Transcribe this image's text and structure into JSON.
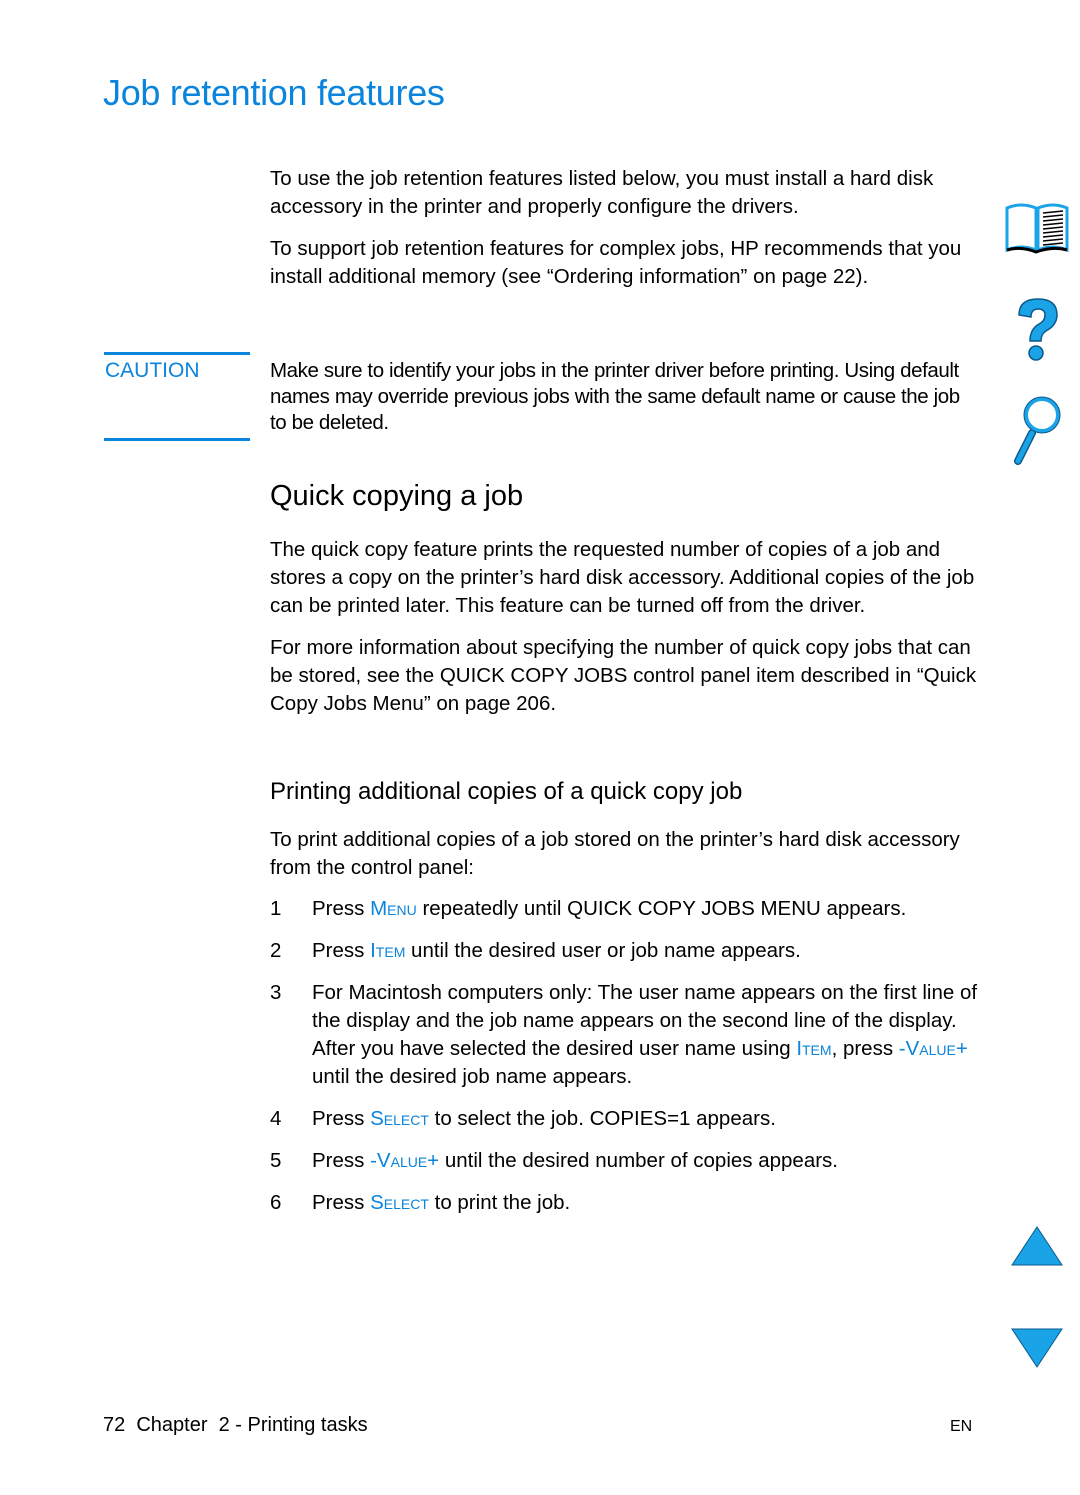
{
  "page": {
    "title": "Job retention features",
    "intro": [
      "To use the job retention features listed below, you must install a hard disk accessory in the printer and properly configure the drivers.",
      "To support job retention features for complex jobs, HP recommends that you install additional memory (see “Ordering information” on page 22)."
    ],
    "caution": {
      "label": "CAUTION",
      "text": "Make sure to identify your jobs in the printer driver before printing. Using default names may override previous jobs with the same default name or cause the job to be deleted."
    },
    "section": {
      "heading": "Quick copying a job",
      "paragraphs": [
        "The quick copy feature prints the requested number of copies of a job and stores a copy on the printer’s hard disk accessory. Additional copies of the job can be printed later. This feature can be turned off from the driver."
      ],
      "more_info": {
        "before": "For more information about specifying the number of quick copy jobs that can be stored, see the ",
        "item": "QUICK COPY JOBS",
        "after": " control panel item described in “Quick Copy Jobs Menu” on page 206."
      }
    },
    "subsection": {
      "heading": "Printing additional copies of a quick copy job",
      "intro": "To print additional copies of a job stored on the printer’s hard disk accessory from the control panel:",
      "steps": [
        {
          "num": "1",
          "parts": [
            {
              "t": "Press "
            },
            {
              "t": "Menu",
              "key": true
            },
            {
              "t": " repeatedly until QUICK COPY JOBS MENU appears."
            }
          ]
        },
        {
          "num": "2",
          "parts": [
            {
              "t": "Press "
            },
            {
              "t": "Item",
              "key": true
            },
            {
              "t": " until the desired user or job name appears."
            }
          ]
        },
        {
          "num": "3",
          "parts": [
            {
              "t": "For Macintosh computers only: The user name appears on the first line of the display and the job name appears on the second line of the display. After you have selected the desired user name using "
            },
            {
              "t": "Item",
              "key": true
            },
            {
              "t": ", press "
            },
            {
              "t": "-Value+",
              "key": true
            },
            {
              "t": " until the desired job name appears."
            }
          ]
        },
        {
          "num": "4",
          "parts": [
            {
              "t": "Press "
            },
            {
              "t": "Select",
              "key": true
            },
            {
              "t": " to select the job. COPIES=1 appears."
            }
          ]
        },
        {
          "num": "5",
          "parts": [
            {
              "t": "Press "
            },
            {
              "t": "-Value+",
              "key": true
            },
            {
              "t": " until the desired number of copies appears."
            }
          ]
        },
        {
          "num": "6",
          "parts": [
            {
              "t": "Press "
            },
            {
              "t": "Select",
              "key": true
            },
            {
              "t": " to print the job."
            }
          ]
        }
      ]
    },
    "footer": {
      "left": "72  Chapter  2 - Printing tasks",
      "right": "EN"
    }
  },
  "nav_icons": [
    {
      "name": "book-icon",
      "label": "Contents"
    },
    {
      "name": "help-icon",
      "label": "Help"
    },
    {
      "name": "search-icon",
      "label": "Search"
    },
    {
      "name": "previous-page-icon",
      "label": "Previous page"
    },
    {
      "name": "next-page-icon",
      "label": "Next page"
    }
  ],
  "colors": {
    "accent": "#0a84dc",
    "icon_fill": "#1ba3e8"
  }
}
